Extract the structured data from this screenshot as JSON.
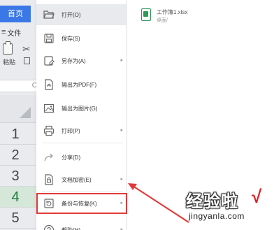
{
  "ribbon": {
    "home_tab": "首页",
    "file_menu": "文件",
    "paste_label": "粘贴",
    "name_box": "C"
  },
  "sheet": {
    "row_numbers": [
      "1",
      "2",
      "3",
      "4",
      "5"
    ],
    "active_row": "4"
  },
  "file_menu": {
    "items": [
      {
        "label": "打开(O)",
        "icon": "folder-open-icon",
        "has_submenu": false
      },
      {
        "label": "保存(S)",
        "icon": "save-icon",
        "has_submenu": false
      },
      {
        "label": "另存为(A)",
        "icon": "save-as-icon",
        "has_submenu": true
      },
      {
        "label": "输出为PDF(F)",
        "icon": "pdf-export-icon",
        "has_submenu": false
      },
      {
        "label": "输出为图片(G)",
        "icon": "image-export-icon",
        "has_submenu": false
      },
      {
        "label": "打印(P)",
        "icon": "printer-icon",
        "has_submenu": true
      },
      {
        "label": "分享(D)",
        "icon": "share-icon",
        "has_submenu": false
      },
      {
        "label": "文档加密(E)",
        "icon": "lock-icon",
        "has_submenu": true
      },
      {
        "label": "备份与恢复(K)",
        "icon": "backup-icon",
        "has_submenu": true
      },
      {
        "label": "帮助(H)",
        "icon": "help-icon",
        "has_submenu": true
      }
    ],
    "highlighted_item": "备份与恢复(K)"
  },
  "recent": {
    "file_name": "工作簿1.xlsx",
    "file_path": "桌面/"
  },
  "watermark": {
    "title": "经验啦",
    "check": "√",
    "url": "jingyanla.com"
  },
  "colors": {
    "accent": "#3b78e7",
    "highlight_border": "#e23a3a",
    "excel_green": "#2e9b5a"
  }
}
